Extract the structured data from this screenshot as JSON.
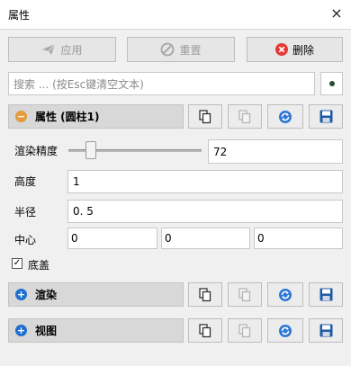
{
  "window": {
    "title": "属性",
    "close_glyph": "×"
  },
  "toolbar": {
    "apply_label": "应用",
    "reset_label": "重置",
    "delete_label": "删除"
  },
  "search": {
    "placeholder": "搜索 ... (按Esc键清空文本)"
  },
  "sections": {
    "properties": {
      "title": "属性 (圆柱1)",
      "toggle": "−"
    },
    "render": {
      "title": "渲染",
      "toggle": "+"
    },
    "view": {
      "title": "视图",
      "toggle": "+"
    }
  },
  "fields": {
    "precision": {
      "label": "渲染精度",
      "value": "72",
      "slider_fraction": 0.17
    },
    "height": {
      "label": "高度",
      "value": "1"
    },
    "radius": {
      "label": "半径",
      "value": "0. 5"
    },
    "center": {
      "label": "中心",
      "x": "0",
      "y": "0",
      "z": "0"
    },
    "base": {
      "label": "底盖",
      "checked": true,
      "check_glyph": "✓"
    }
  },
  "colors": {
    "delete_red": "#e53935",
    "expand_blue": "#1e6fd0",
    "collapse_orange": "#e39b3c",
    "refresh_blue": "#2d78d6",
    "save_blue": "#1f5aa6"
  }
}
